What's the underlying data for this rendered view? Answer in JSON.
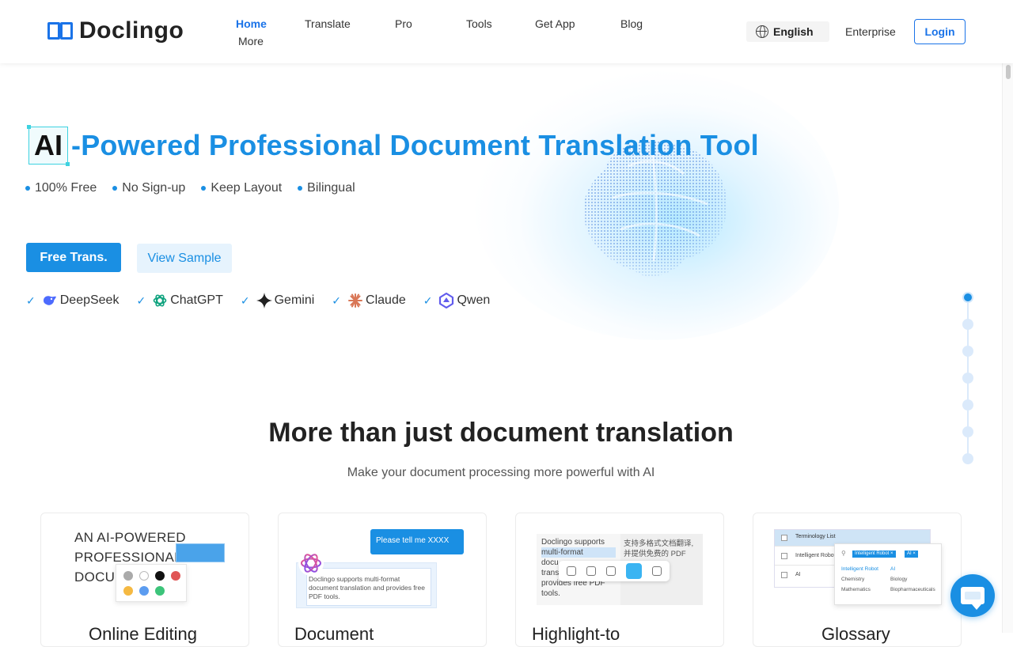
{
  "header": {
    "logo_text": "Doclingo",
    "nav": [
      {
        "label": "Home",
        "active": true
      },
      {
        "label": "Translate"
      },
      {
        "label": "Pro"
      },
      {
        "label": "Tools"
      },
      {
        "label": "Get App"
      },
      {
        "label": "Blog"
      },
      {
        "label": "More"
      }
    ],
    "language": "English",
    "enterprise": "Enterprise",
    "login": "Login"
  },
  "hero": {
    "title_ai": "AI",
    "title_rest": "-Powered Professional Document Translation Tool",
    "features": [
      "100% Free",
      "No Sign-up",
      "Keep Layout",
      "Bilingual"
    ],
    "primary_button": "Free Trans.",
    "secondary_button": "View Sample",
    "models": [
      {
        "name": "DeepSeek",
        "icon": "deepseek-icon"
      },
      {
        "name": "ChatGPT",
        "icon": "chatgpt-icon"
      },
      {
        "name": "Gemini",
        "icon": "gemini-icon"
      },
      {
        "name": "Claude",
        "icon": "claude-icon"
      },
      {
        "name": "Qwen",
        "icon": "qwen-icon"
      }
    ]
  },
  "steps": {
    "count": 7,
    "active": 0
  },
  "section": {
    "title": "More than just document translation",
    "subtitle": "Make your document processing more powerful with AI",
    "cards": [
      {
        "title": "Online Editing",
        "preview_text": [
          "AN AI-POWERED",
          "PROFESSIONAL",
          "DOCUM"
        ]
      },
      {
        "title": "Document",
        "bubble": "Please tell me XXXX",
        "doc_text": "Doclingo supports multi-format document translation and provides free PDF tools."
      },
      {
        "title": "Highlight-to",
        "left_text": [
          "Doclingo supports",
          "multi-format",
          "docu",
          "trans",
          "provides free PDF",
          "tools."
        ],
        "right_text": [
          "支持多格式文档翻译,",
          "并提供免费的 PDF"
        ]
      },
      {
        "title": "Glossary",
        "table_header": "Terminology List",
        "rows": [
          "Intelligent Robot",
          "AI"
        ],
        "tags": [
          "Intelligent Robot ×",
          "AI ×"
        ],
        "options": [
          "Intelligent Robot",
          "AI",
          "Chemistry",
          "Biology",
          "Mathematics",
          "Biopharmaceuticals"
        ]
      }
    ]
  },
  "colors": {
    "accent": "#1a8fe3",
    "brand": "#1a73e8"
  }
}
